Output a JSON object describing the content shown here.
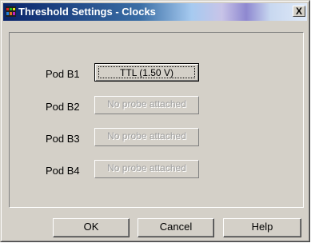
{
  "window": {
    "title": "Threshold Settings - Clocks",
    "close_label": "X"
  },
  "pods": [
    {
      "label": "Pod B1",
      "button": "TTL (1.50 V)",
      "enabled": true
    },
    {
      "label": "Pod B2",
      "button": "No probe attached",
      "enabled": false
    },
    {
      "label": "Pod B3",
      "button": "No probe attached",
      "enabled": false
    },
    {
      "label": "Pod B4",
      "button": "No probe attached",
      "enabled": false
    }
  ],
  "footer": {
    "ok_label": "OK",
    "cancel_label": "Cancel",
    "help_label": "Help"
  }
}
